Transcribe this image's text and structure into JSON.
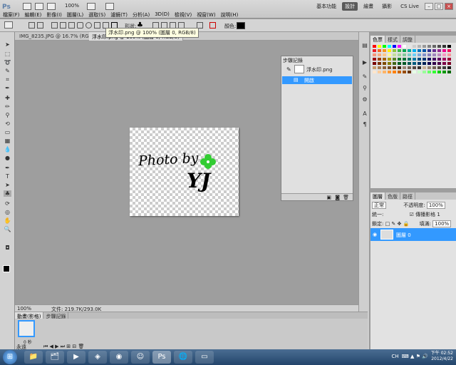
{
  "app": {
    "logo": "Ps",
    "zoom": "100%",
    "menu": [
      "檔案(F)",
      "編輯(E)",
      "影像(I)",
      "圖層(L)",
      "選取(S)",
      "濾鏡(T)",
      "分析(A)",
      "3D(D)",
      "檢視(V)",
      "視窗(W)",
      "說明(H)"
    ],
    "workspaces": [
      "基本功能",
      "設計",
      "繪畫",
      "攝影"
    ],
    "active_workspace": "設計",
    "cs_live": "CS Live"
  },
  "options": {
    "shape_label": "形狀:",
    "color_label": "顏色:"
  },
  "tooltip": "浮水印.png @ 100% (圖層 0, RGB/8)",
  "document_tabs": [
    {
      "label": "IMG_8235.JPG @ 16.7% (RGB/8*)"
    },
    {
      "label": "浮水印.png @ 100% (圖層 0, RGB/8)"
    }
  ],
  "canvas": {
    "watermark_text": "Photo by",
    "watermark_initials": "YJ"
  },
  "status": {
    "zoom": "100%",
    "file": "文件: 219.7K/293.0K"
  },
  "history": {
    "tab": "步驟記錄",
    "snapshot": "浮水印.png",
    "step": "開啟"
  },
  "swatches": {
    "tabs": [
      "色票",
      "樣式",
      "調整"
    ],
    "colors": [
      "#ff0000",
      "#ffff00",
      "#00ff00",
      "#00ffff",
      "#0000ff",
      "#ff00ff",
      "#ffffff",
      "#e6e6e6",
      "#cccccc",
      "#b3b3b3",
      "#999999",
      "#808080",
      "#666666",
      "#4d4d4d",
      "#333333",
      "#000000",
      "#ed1c24",
      "#f26522",
      "#f7941d",
      "#fff200",
      "#8dc63f",
      "#39b54a",
      "#00a651",
      "#00a99d",
      "#00aeef",
      "#0072bc",
      "#0054a6",
      "#2e3192",
      "#662d91",
      "#92278f",
      "#ec008c",
      "#ed145b",
      "#f7977a",
      "#f9ad81",
      "#fdc68a",
      "#fff79a",
      "#c4df9b",
      "#a3d39c",
      "#82ca9c",
      "#7accc8",
      "#6dcff6",
      "#7da7d9",
      "#8393ca",
      "#8781bd",
      "#a187be",
      "#bd8cbf",
      "#f49ac2",
      "#f6989d",
      "#9e0b0f",
      "#a0410d",
      "#a36209",
      "#aba000",
      "#598527",
      "#197b30",
      "#007236",
      "#00746b",
      "#0076a3",
      "#004b80",
      "#003471",
      "#1b1464",
      "#440e62",
      "#630460",
      "#9e005d",
      "#9e0039",
      "#790000",
      "#7b2e00",
      "#7d4900",
      "#827b00",
      "#406618",
      "#005e20",
      "#005826",
      "#005952",
      "#005b7f",
      "#003663",
      "#002157",
      "#0d004c",
      "#32004b",
      "#4b0049",
      "#7b0046",
      "#7a0026",
      "#c69c6d",
      "#a67c52",
      "#8c6239",
      "#754c24",
      "#603913",
      "#3c2415",
      "#998675",
      "#736357",
      "#534741",
      "#362f2d",
      "#c7b299",
      "#998675",
      "#736357",
      "#534741",
      "#3d3d3d",
      "#1a1a1a",
      "#ffe6cc",
      "#ffcc99",
      "#ffb366",
      "#ff9933",
      "#ff8000",
      "#cc6600",
      "#994d00",
      "#663300",
      "#e6ffe6",
      "#ccffcc",
      "#99ff99",
      "#66ff66",
      "#33ff33",
      "#00cc00",
      "#009900",
      "#006600"
    ]
  },
  "layers": {
    "tabs": [
      "圖層",
      "色版",
      "路徑"
    ],
    "blend_mode": "正常",
    "opacity_label": "不透明度:",
    "opacity": "100%",
    "unify_label": "統一:",
    "propagate_label": "傳播影格 1",
    "lock_label": "鎖定:",
    "fill_label": "填滿:",
    "fill": "100%",
    "layer_name": "圖層 0"
  },
  "filmstrip": {
    "tabs": [
      "動畫(影格)",
      "步驟記錄"
    ],
    "frame_time": "0 秒",
    "loop": "永遠"
  },
  "taskbar": {
    "clock_time": "下午 02:52",
    "clock_date": "2012/4/22",
    "lang": "CH"
  }
}
